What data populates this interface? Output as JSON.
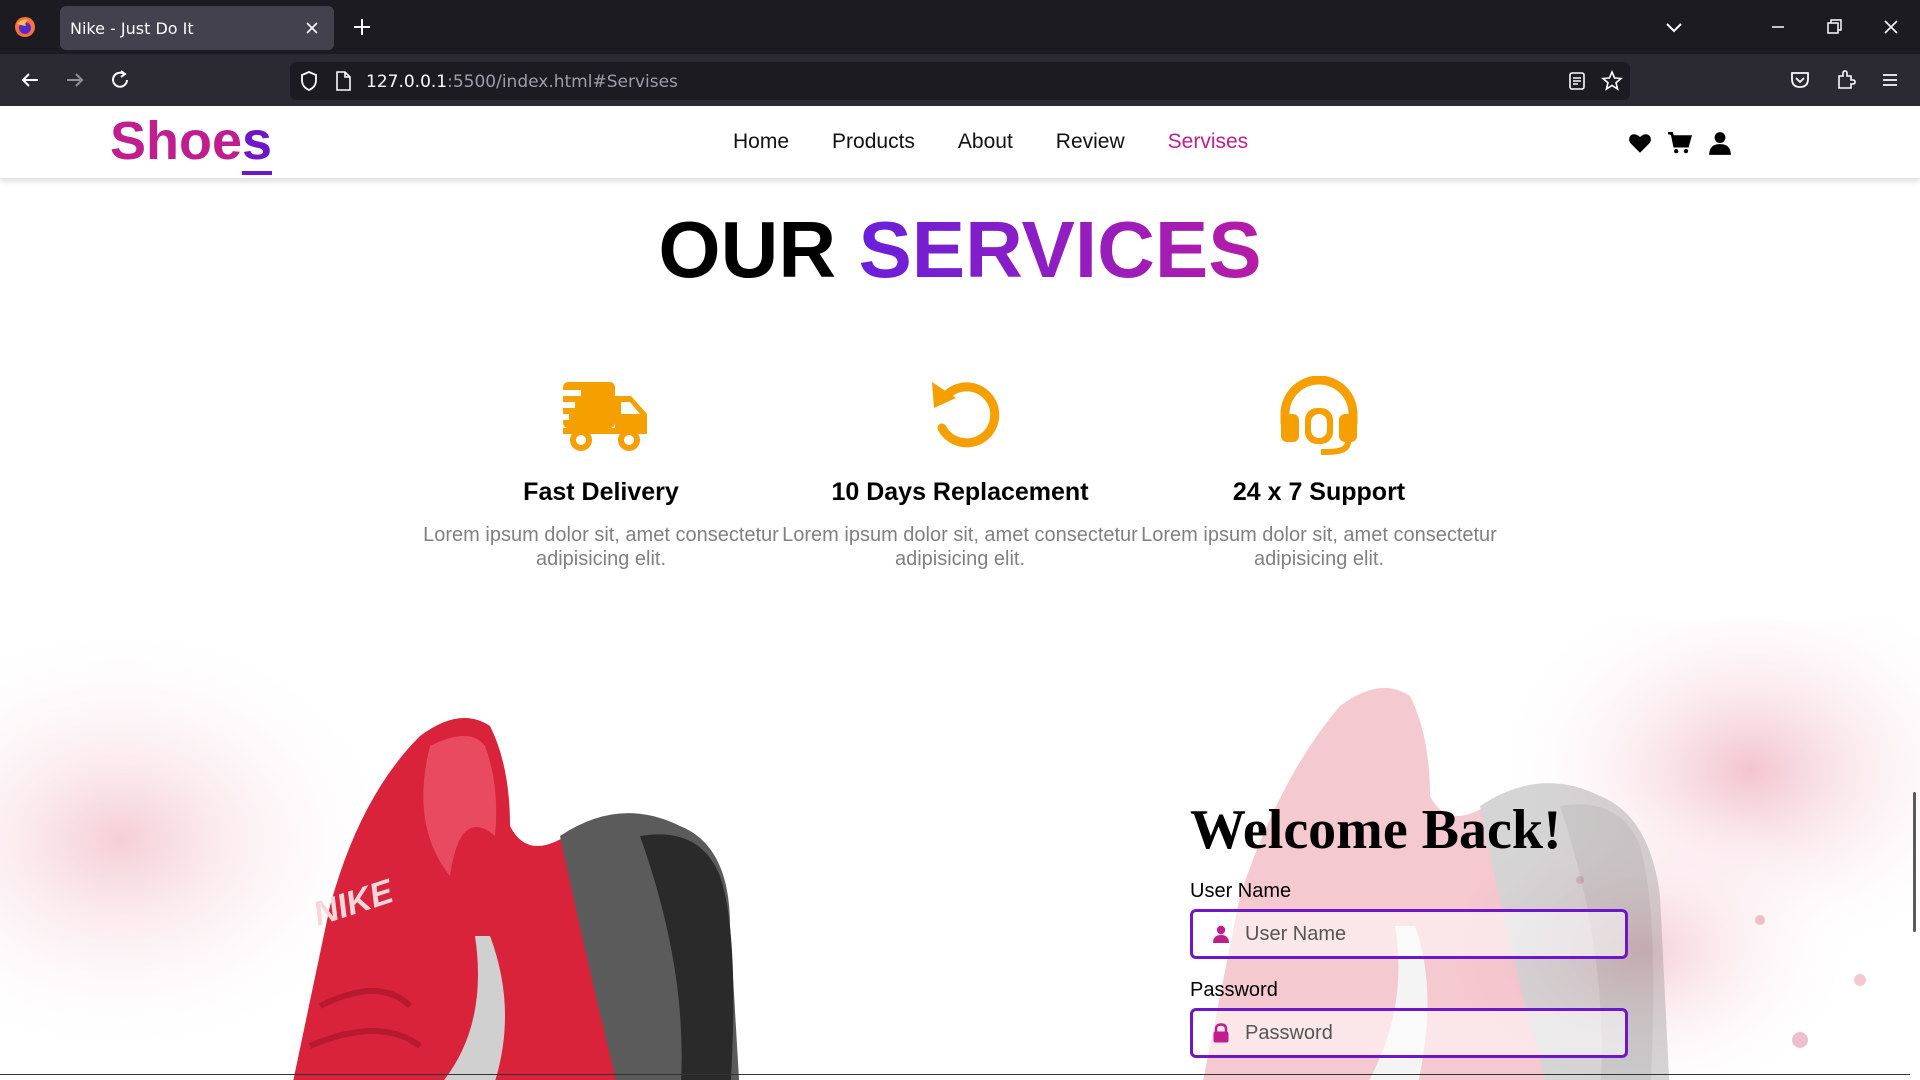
{
  "browser": {
    "tab_title": "Nike - Just Do It",
    "url_host": "127.0.0.1",
    "url_rest": ":5500/index.html#Servises"
  },
  "header": {
    "logo_main": "Shoe",
    "logo_last": "s",
    "menu": [
      {
        "label": "Home"
      },
      {
        "label": "Products"
      },
      {
        "label": "About"
      },
      {
        "label": "Review"
      },
      {
        "label": "Servises",
        "active": true
      }
    ],
    "icons": [
      "heart-icon",
      "cart-icon",
      "user-icon"
    ]
  },
  "services": {
    "title_plain": "OUR",
    "title_accent": "SERVICES",
    "items": [
      {
        "icon": "truck-icon",
        "title": "Fast Delivery",
        "text": "Lorem ipsum dolor sit, amet consectetur adipisicing elit."
      },
      {
        "icon": "replacement-icon",
        "title": "10 Days Replacement",
        "text": "Lorem ipsum dolor sit, amet consectetur adipisicing elit."
      },
      {
        "icon": "headset-icon",
        "title": "24 x 7 Support",
        "text": "Lorem ipsum dolor sit, amet consectetur adipisicing elit."
      }
    ]
  },
  "login": {
    "heading": "Welcome Back!",
    "username_label": "User Name",
    "username_placeholder": "User Name",
    "password_label": "Password",
    "password_placeholder": "Password"
  },
  "colors": {
    "brand": "#c01e8e",
    "accent": "#6f16c9",
    "icon_orange": "#f5a000"
  }
}
